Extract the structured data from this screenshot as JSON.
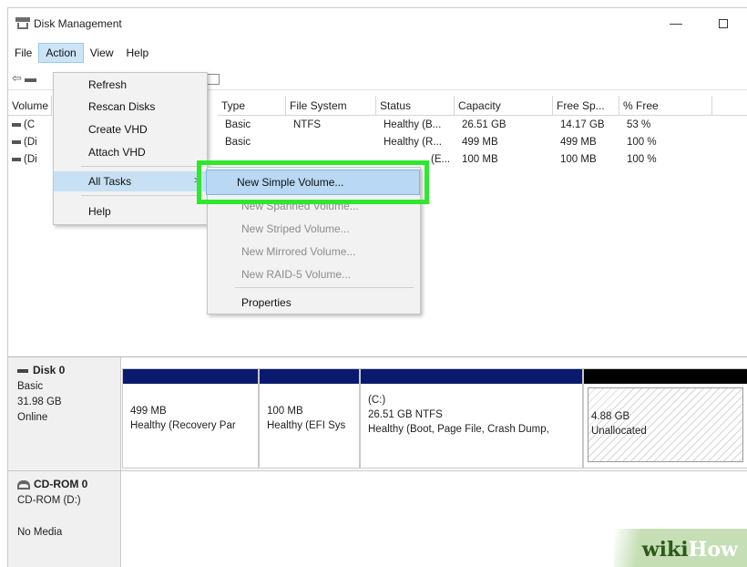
{
  "window": {
    "title": "Disk Management",
    "minimize_glyph": "—"
  },
  "menubar": {
    "items": [
      "File",
      "Action",
      "View",
      "Help"
    ]
  },
  "volume_table": {
    "columns": [
      "Volume",
      "Type",
      "File System",
      "Status",
      "Capacity",
      "Free Sp...",
      "% Free"
    ],
    "rows": [
      {
        "volume": "(C",
        "type": "Basic",
        "fs": "NTFS",
        "status": "Healthy (B...",
        "capacity": "26.51 GB",
        "free": "14.17 GB",
        "pct": "53 %"
      },
      {
        "volume": "(Di",
        "type": "Basic",
        "fs": "",
        "status": "Healthy (R...",
        "capacity": "499 MB",
        "free": "499 MB",
        "pct": "100 %"
      },
      {
        "volume": "(Di",
        "type": "",
        "fs": "",
        "status": "(E...",
        "capacity": "100 MB",
        "free": "100 MB",
        "pct": "100 %"
      }
    ]
  },
  "action_menu": {
    "items": [
      "Refresh",
      "Rescan Disks",
      "Create VHD",
      "Attach VHD",
      "All Tasks",
      "Help"
    ],
    "submenu_arrow": ">"
  },
  "all_tasks_submenu": {
    "items": [
      "New Simple Volume...",
      "New Spanned Volume...",
      "New Striped Volume...",
      "New Mirrored Volume...",
      "New RAID-5 Volume...",
      "Properties"
    ]
  },
  "disks": {
    "disk0": {
      "name": "Disk 0",
      "type": "Basic",
      "size": "31.98 GB",
      "state": "Online",
      "partitions": [
        {
          "label": "",
          "size": "499 MB",
          "status": "Healthy (Recovery Par"
        },
        {
          "label": "",
          "size": "100 MB",
          "status": "Healthy (EFI Sys"
        },
        {
          "label": "(C:)",
          "size": "26.51 GB NTFS",
          "status": "Healthy (Boot, Page File, Crash Dump,"
        },
        {
          "label": "",
          "size": "4.88 GB",
          "status": "Unallocated"
        }
      ]
    },
    "cdrom0": {
      "name": "CD-ROM 0",
      "drive": "CD-ROM (D:)",
      "media": "No Media"
    }
  },
  "watermark": {
    "wiki": "wiki",
    "how": "How"
  },
  "colors": {
    "highlight_border": "#2ee82e",
    "partition_bar": "#0a1a6e",
    "unallocated_bar": "#000000",
    "menu_highlight": "#c7e0f4"
  }
}
